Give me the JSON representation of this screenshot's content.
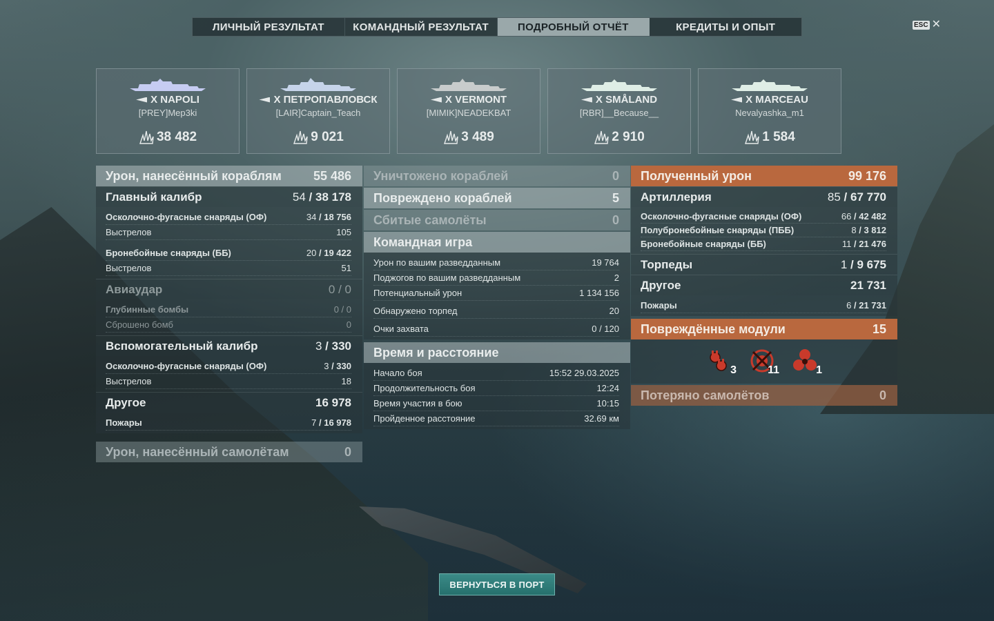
{
  "tabs": [
    {
      "label": "ЛИЧНЫЙ РЕЗУЛЬТАТ"
    },
    {
      "label": "КОМАНДНЫЙ РЕЗУЛЬТАТ"
    },
    {
      "label": "ПОДРОБНЫЙ ОТЧЁТ",
      "active": true
    },
    {
      "label": "КРЕДИТЫ И ОПЫТ"
    }
  ],
  "esc": {
    "key": "ESC",
    "close": "✕"
  },
  "players": [
    {
      "ship": "X NAPOLI",
      "player": "[PREY]Mep3ki",
      "score": "38 482"
    },
    {
      "ship": "X ПЕТРОПАВЛОВСК",
      "player": "[LAIR]Captain_Teach",
      "score": "9 021"
    },
    {
      "ship": "X VERMONT",
      "player": "[MIMIK]NEADEKBAT",
      "score": "3 489"
    },
    {
      "ship": "X SMÅLAND",
      "player": "[RBR]__Because__",
      "score": "2 910"
    },
    {
      "ship": "X MARCEAU",
      "player": "Nevalyashka_m1",
      "score": "1 584"
    }
  ],
  "left": {
    "damage_header": {
      "label": "Урон, нанесённый кораблям",
      "value": "55 486"
    },
    "main_caliber": {
      "label": "Главный калибр",
      "hits": "54",
      "value": "38 178"
    },
    "he_label": "Осколочно-фугасные снаряды (ОФ)",
    "he_hits": "34",
    "he_value": "18 756",
    "he_shots_label": "Выстрелов",
    "he_shots": "105",
    "ap_label": "Бронебойные снаряды (ББ)",
    "ap_hits": "20",
    "ap_value": "19 422",
    "ap_shots_label": "Выстрелов",
    "ap_shots": "51",
    "airstrike": {
      "label": "Авиаудар",
      "hits": "0",
      "value": "0"
    },
    "depth_label": "Глубинные бомбы",
    "depth_hits": "0",
    "depth_value": "0",
    "bombs_label": "Сброшено бомб",
    "bombs_value": "0",
    "secondary": {
      "label": "Вспомогательный калибр",
      "hits": "3",
      "value": "330"
    },
    "sec_he_label": "Осколочно-фугасные снаряды (ОФ)",
    "sec_he_hits": "3",
    "sec_he_value": "330",
    "sec_shots_label": "Выстрелов",
    "sec_shots": "18",
    "other": {
      "label": "Другое",
      "value": "16 978"
    },
    "fires_label": "Пожары",
    "fires_hits": "7",
    "fires_value": "16 978",
    "planes_header": {
      "label": "Урон, нанесённый самолётам",
      "value": "0"
    }
  },
  "middle": {
    "destroyed": {
      "label": "Уничтожено кораблей",
      "value": "0"
    },
    "damaged": {
      "label": "Повреждено кораблей",
      "value": "5"
    },
    "planes_shot": {
      "label": "Сбитые самолёты",
      "value": "0"
    },
    "team_play": {
      "label": "Командная игра"
    },
    "team_rows": [
      {
        "label": "Урон по вашим разведданным",
        "value": "19 764"
      },
      {
        "label": "Поджогов по вашим разведданным",
        "value": "2"
      },
      {
        "label": "Потенциальный урон",
        "value": "1 134 156"
      },
      {
        "label": "Обнаружено торпед",
        "value": "20"
      },
      {
        "label": "Очки захвата",
        "value": "0 / 120"
      }
    ],
    "time": {
      "label": "Время и расстояние"
    },
    "time_rows": [
      {
        "label": "Начало боя",
        "value": "15:52  29.03.2025"
      },
      {
        "label": "Продолжительность боя",
        "value": "12:24"
      },
      {
        "label": "Время участия в бою",
        "value": "10:15"
      },
      {
        "label": "Пройденное расстояние",
        "value": "32.69 км"
      }
    ]
  },
  "right": {
    "received": {
      "label": "Полученный урон",
      "value": "99 176"
    },
    "artillery": {
      "label": "Артиллерия",
      "hits": "85",
      "value": "67 770"
    },
    "art_rows": [
      {
        "label": "Осколочно-фугасные снаряды (ОФ)",
        "hits": "66",
        "value": "42 482"
      },
      {
        "label": "Полубронебойные снаряды (ПББ)",
        "hits": "8",
        "value": "3 812"
      },
      {
        "label": "Бронебойные снаряды (ББ)",
        "hits": "11",
        "value": "21 476"
      }
    ],
    "torpedoes": {
      "label": "Торпеды",
      "hits": "1",
      "value": "9 675"
    },
    "other": {
      "label": "Другое",
      "value": "21 731"
    },
    "fires_label": "Пожары",
    "fires_hits": "6",
    "fires_value": "21 731",
    "modules": {
      "label": "Повреждённые модули",
      "value": "15"
    },
    "module_icons": [
      {
        "icon": "turret-icon",
        "count": "3"
      },
      {
        "icon": "fire-control-icon",
        "count": "11"
      },
      {
        "icon": "propeller-icon",
        "count": "1"
      }
    ],
    "planes_lost": {
      "label": "Потеряно самолётов",
      "value": "0"
    }
  },
  "back_button": "ВЕРНУТЬСЯ В ПОРТ",
  "colors": {
    "accent_orange": "#b9683e",
    "button_teal": "#2f7d7a",
    "active_tab": "#9aa8aa"
  }
}
